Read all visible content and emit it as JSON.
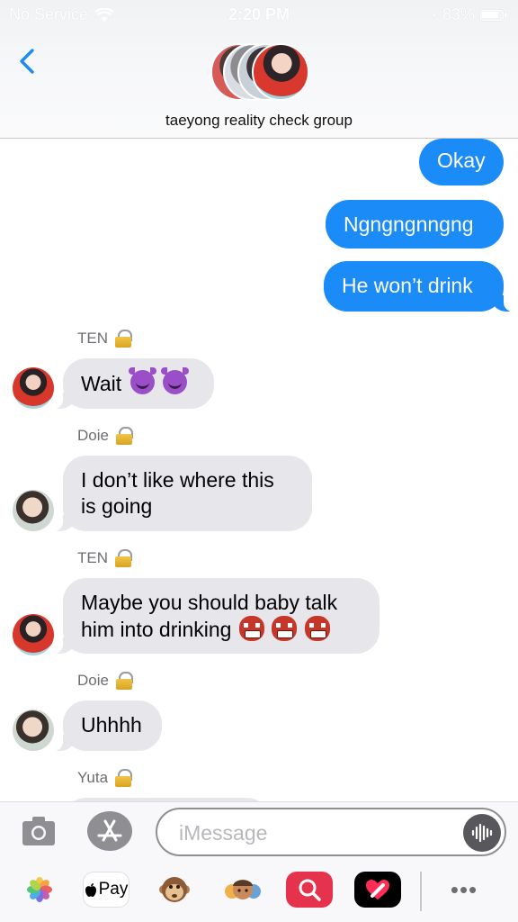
{
  "status_bar": {
    "carrier": "No Service",
    "time": "2:20 PM",
    "battery": "83%"
  },
  "header": {
    "group_name": "taeyong reality check group"
  },
  "messages": [
    {
      "type": "sent",
      "text": "Okay"
    },
    {
      "type": "sent",
      "text": "Ngngngnngng"
    },
    {
      "type": "sent",
      "text": "He won’t drink"
    },
    {
      "type": "received",
      "sender": "TEN",
      "text": "Wait",
      "emoji": [
        "smiling-imp",
        "smiling-imp"
      ]
    },
    {
      "type": "received",
      "sender": "Doie",
      "text": "I don’t like where this\nis going"
    },
    {
      "type": "received",
      "sender": "TEN",
      "text": "Maybe you should baby talk\nhim into drinking",
      "emoji": [
        "japanese-ogre",
        "japanese-ogre",
        "japanese-ogre"
      ]
    },
    {
      "type": "received",
      "sender": "Doie",
      "text": "Uhhhh"
    },
    {
      "type": "received",
      "sender": "Yuta",
      "text": ""
    }
  ],
  "input_bar": {
    "placeholder": "iMessage"
  },
  "app_drawer": {
    "apple_pay_label": "Pay",
    "apps": [
      "photos-icon",
      "apple-pay-icon",
      "animoji-icon",
      "memoji-icon",
      "search-images-icon",
      "digital-touch-icon",
      "more-icon"
    ]
  },
  "colors": {
    "sent_bubble": "#1b8bf7",
    "received_bubble": "#e6e6eb",
    "back_chevron": "#1b8bf7"
  }
}
